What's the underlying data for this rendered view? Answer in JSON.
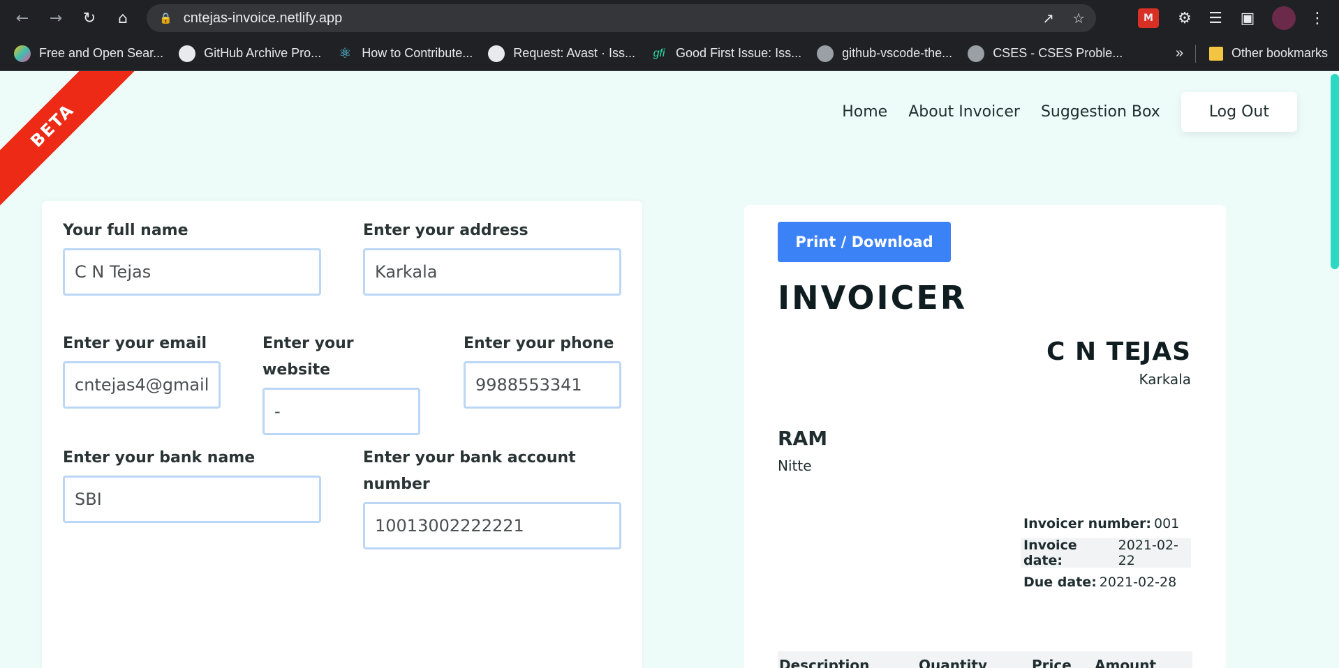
{
  "browser": {
    "url": "cntejas-invoice.netlify.app",
    "bookmarks": [
      {
        "label": "Free and Open Sear...",
        "icon": "elastic-icon"
      },
      {
        "label": "GitHub Archive Pro...",
        "icon": "github-icon"
      },
      {
        "label": "How to Contribute...",
        "icon": "react-icon"
      },
      {
        "label": "Request: Avast · Iss...",
        "icon": "github-icon"
      },
      {
        "label": "Good First Issue: Iss...",
        "icon": "gfi-icon"
      },
      {
        "label": "github-vscode-the...",
        "icon": "globe-icon"
      },
      {
        "label": "CSES - CSES Proble...",
        "icon": "globe-icon"
      }
    ],
    "more_label": "»",
    "other_bookmarks": "Other bookmarks",
    "gfi_mark": "gfi"
  },
  "banner": {
    "label": "BETA"
  },
  "nav": {
    "home": "Home",
    "about": "About Invoicer",
    "suggestion": "Suggestion Box",
    "logout": "Log Out"
  },
  "form": {
    "name": {
      "label": "Your full name",
      "value": "C N Tejas"
    },
    "address": {
      "label": "Enter your address",
      "value": "Karkala"
    },
    "email": {
      "label": "Enter your email",
      "value": "cntejas4@gmail"
    },
    "website": {
      "label": "Enter your website",
      "value": "-"
    },
    "phone": {
      "label": "Enter your phone",
      "value": "9988553341"
    },
    "bank_name": {
      "label": "Enter your bank name",
      "value": "SBI"
    },
    "bank_account": {
      "label": "Enter your bank account number",
      "value": "10013002222221"
    }
  },
  "invoice": {
    "print_button": "Print / Download",
    "title": "INVOICER",
    "seller_name": "C N TEJAS",
    "seller_address": "Karkala",
    "client_name": "RAM",
    "client_address": "Nitte",
    "meta": [
      {
        "label": "Invoicer number:",
        "value": "001"
      },
      {
        "label": "Invoice date:",
        "value": "2021-02-22"
      },
      {
        "label": "Due date:",
        "value": "2021-02-28"
      }
    ],
    "table_headers": [
      "Description",
      "Quantity",
      "Price",
      "Amount"
    ]
  },
  "colors": {
    "page_bg": "#eefcf9",
    "beta_red": "#ec2a16",
    "print_blue": "#3b82f6",
    "input_border": "#bcd6f6",
    "scroll_thumb": "#2bd8c2"
  }
}
